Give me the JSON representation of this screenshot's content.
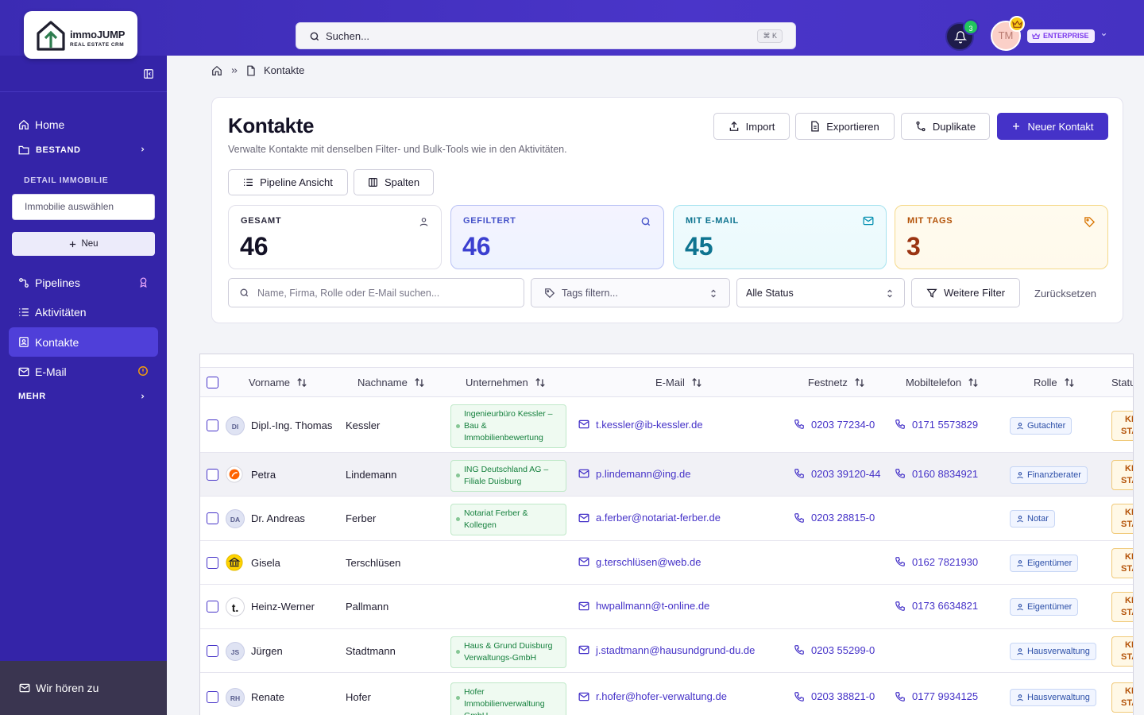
{
  "app": {
    "brand": "immoJUMP",
    "brand_sub": "REAL ESTATE CRM",
    "colors": {
      "primary": "#4532c8",
      "sidebar": "#3424a8",
      "topbar": "#3b2bb3"
    }
  },
  "topbar": {
    "search_placeholder": "Suchen...",
    "search_shortcut": "⌘ K",
    "notifications_count": "3",
    "user_initials": "TM",
    "plan_badge": "ENTERPRISE"
  },
  "sidebar": {
    "home": "Home",
    "bestand": "BESTAND",
    "detail_label": "DETAIL IMMOBILIE",
    "property_select": "Immobilie auswählen",
    "new_button": "Neu",
    "pipelines": "Pipelines",
    "aktivitaeten": "Aktivitäten",
    "kontakte": "Kontakte",
    "email": "E-Mail",
    "mehr": "MEHR",
    "feedback": "Wir hören zu"
  },
  "breadcrumb": {
    "current": "Kontakte"
  },
  "page": {
    "title": "Kontakte",
    "subtitle": "Verwalte Kontakte mit denselben Filter- und Bulk-Tools wie in den Aktivitäten.",
    "import": "Import",
    "export": "Exportieren",
    "duplicates": "Duplikate",
    "new_contact": "Neuer Kontakt",
    "pipeline_view": "Pipeline Ansicht",
    "columns": "Spalten"
  },
  "stats": [
    {
      "label": "GESAMT",
      "value": "46",
      "color": "#141226"
    },
    {
      "label": "GEFILTERT",
      "value": "46",
      "color": "#3b3fd0"
    },
    {
      "label": "MIT E-MAIL",
      "value": "45",
      "color": "#0e7490"
    },
    {
      "label": "MIT TAGS",
      "value": "3",
      "color": "#9a3412"
    }
  ],
  "filters": {
    "search_placeholder": "Name, Firma, Rolle oder E-Mail suchen...",
    "tags_placeholder": "Tags filtern...",
    "status_value": "Alle Status",
    "more_filters": "Weitere Filter",
    "reset": "Zurücksetzen"
  },
  "table": {
    "columns": [
      "Vorname",
      "Nachname",
      "Unternehmen",
      "E-Mail",
      "Festnetz",
      "Mobiltelefon",
      "Rolle",
      "Status"
    ],
    "rows": [
      {
        "avatar": "DI",
        "vorname": "Dipl.-Ing. Thomas",
        "nachname": "Kessler",
        "company": "Ingenieurbüro Kessler – Bau & Immobilienbewertung",
        "email": "t.kessler@ib-kessler.de",
        "phone": "0203 77234-0",
        "mobile": "0171 5573829",
        "role": "Gutachter",
        "status1": "KE",
        "status2": "STA"
      },
      {
        "avatar": "",
        "vorname": "Petra",
        "nachname": "Lindemann",
        "company": "ING Deutschland AG – Filiale Duisburg",
        "email": "p.lindemann@ing.de",
        "phone": "0203 39120-44",
        "mobile": "0160 8834921",
        "role": "Finanzberater",
        "status1": "KE",
        "status2": "STA"
      },
      {
        "avatar": "DA",
        "vorname": "Dr. Andreas",
        "nachname": "Ferber",
        "company": "Notariat Ferber & Kollegen",
        "email": "a.ferber@notariat-ferber.de",
        "phone": "0203 28815-0",
        "mobile": "",
        "role": "Notar",
        "status1": "KE",
        "status2": "STA"
      },
      {
        "avatar": "",
        "vorname": "Gisela",
        "nachname": "Terschlüsen",
        "company": "",
        "email": "g.terschlüsen@web.de",
        "phone": "",
        "mobile": "0162 7821930",
        "role": "Eigentümer",
        "status1": "KE",
        "status2": "STA"
      },
      {
        "avatar": "t.",
        "vorname": "Heinz-Werner",
        "nachname": "Pallmann",
        "company": "",
        "email": "hwpallmann@t-online.de",
        "phone": "",
        "mobile": "0173 6634821",
        "role": "Eigentümer",
        "status1": "KE",
        "status2": "STA"
      },
      {
        "avatar": "JS",
        "vorname": "Jürgen",
        "nachname": "Stadtmann",
        "company": "Haus & Grund Duisburg Verwaltungs-GmbH",
        "email": "j.stadtmann@hausundgrund-du.de",
        "phone": "0203 55299-0",
        "mobile": "",
        "role": "Hausverwaltung",
        "status1": "KE",
        "status2": "STA"
      },
      {
        "avatar": "RH",
        "vorname": "Renate",
        "nachname": "Hofer",
        "company": "Hofer Immobilienverwaltung GmbH",
        "email": "r.hofer@hofer-verwaltung.de",
        "phone": "0203 38821-0",
        "mobile": "0177 9934125",
        "role": "Hausverwaltung",
        "status1": "KE",
        "status2": "STA"
      }
    ]
  }
}
